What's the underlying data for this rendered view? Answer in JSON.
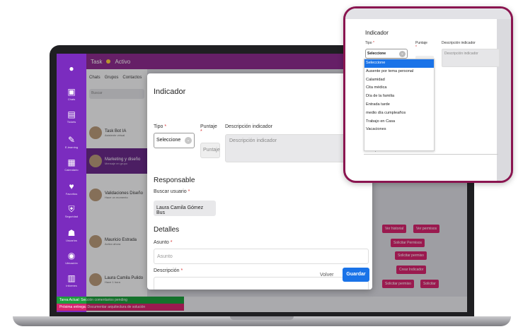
{
  "app": {
    "brand": "Task",
    "status_label": "Activo"
  },
  "sidebar": {
    "items": [
      {
        "icon": "home-icon",
        "glyph": "●",
        "label": ""
      },
      {
        "icon": "chat-icon",
        "glyph": "▣",
        "label": "Chats"
      },
      {
        "icon": "tickets-icon",
        "glyph": "▤",
        "label": "Tickets"
      },
      {
        "icon": "elearning-icon",
        "glyph": "✎",
        "label": "E-learning"
      },
      {
        "icon": "calendar-icon",
        "glyph": "▦",
        "label": "Calendario"
      },
      {
        "icon": "heart-icon",
        "glyph": "♥",
        "label": "Favoritos"
      },
      {
        "icon": "shield-icon",
        "glyph": "⛨",
        "label": "Seguridad"
      },
      {
        "icon": "users-icon",
        "glyph": "☗",
        "label": "Usuarios"
      },
      {
        "icon": "location-icon",
        "glyph": "◉",
        "label": "Ubicación"
      },
      {
        "icon": "reports-icon",
        "glyph": "▥",
        "label": "Informes"
      }
    ]
  },
  "chatlist": {
    "tabs": [
      "Chats",
      "Grupos",
      "Contactos"
    ],
    "search_placeholder": "Buscar",
    "rows": [
      {
        "name": "Task Bot IA",
        "sub": "Asistente virtual"
      },
      {
        "name": "Marketing y diseño",
        "sub": "Mensaje en grupo"
      },
      {
        "name": "Validaciones Diseño",
        "sub": "Hace un momento"
      },
      {
        "name": "Mauricio Estrada",
        "sub": "Activo ahora"
      },
      {
        "name": "Laura Camila Pulido",
        "sub": "Hace 1 hora"
      }
    ]
  },
  "chatarea": {
    "buttons": [
      "Ver historial",
      "Ver permisos",
      "Solicitar Permisos",
      "Solicitar permiso",
      "Crear Indicador",
      "Solicitar permiso",
      "Solicitar"
    ]
  },
  "status_bar": {
    "green": "Tarea Actual: Sección comentarios pending",
    "magenta": "Próxima entrega: Documentar arquitectura de solución"
  },
  "modal": {
    "title": "Indicador",
    "tipo_label": "Tipo",
    "tipo_value": "Seleccione",
    "puntaje_label": "Puntaje",
    "puntaje_placeholder": "Puntaje",
    "descripcion_label": "Descripción indicador",
    "descripcion_placeholder": "Descripción indicador",
    "responsable_heading": "Responsable",
    "buscar_label": "Buscar usuario",
    "buscar_value": "Laura Camila Gómez Bus",
    "detalles_heading": "Detalles",
    "asunto_label": "Asunto",
    "asunto_placeholder": "Asunto",
    "descripcion2_label": "Descripción",
    "volver_label": "Volver",
    "guardar_label": "Guardar"
  },
  "zoom": {
    "title": "Indicador",
    "tipo_label": "Tipo",
    "tipo_value": "Seleccione",
    "puntaje_label": "Puntaje",
    "descripcion_label": "Descripción indicador",
    "descripcion_placeholder": "Descripción indicador",
    "options": [
      "Seleccione",
      "Ausente por tema personal",
      "Calamidad",
      "Cita médica",
      "Día de la familia",
      "Entrada tarde",
      "medio día cumpleaños",
      "Trabajo en Casa",
      "Vacaciones"
    ],
    "selected_index": 0,
    "behind_text": "Descripción"
  },
  "colors": {
    "sidebar": "#7b2cbf",
    "topbar": "#8e2c8f",
    "accent_pink": "#d6246e",
    "accent_blue": "#1a73e8",
    "zoom_border": "#8a1550",
    "status_green": "#1e9e3e"
  }
}
